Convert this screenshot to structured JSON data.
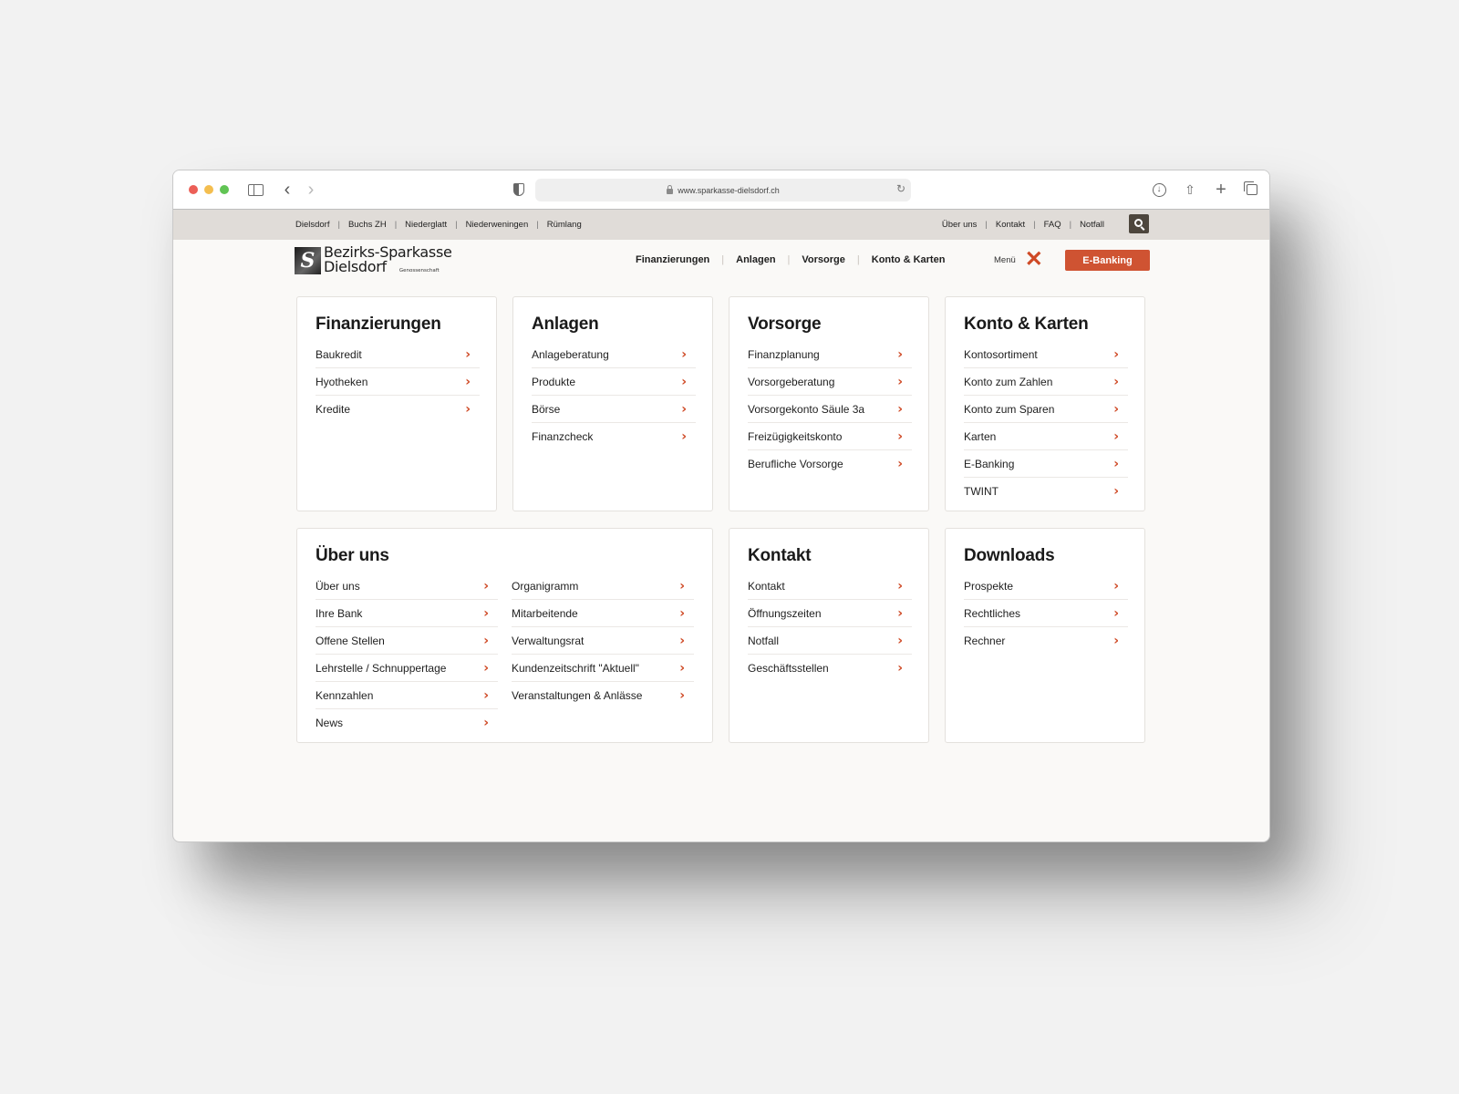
{
  "browser": {
    "url": "www.sparkasse-dielsdorf.ch",
    "icons": [
      "close-dot",
      "minimize-dot",
      "zoom-dot",
      "sidebar-icon",
      "back-icon",
      "forward-icon",
      "shield-icon",
      "lock-icon",
      "reload-icon",
      "download-icon",
      "share-icon",
      "new-tab-icon",
      "tabs-overview-icon"
    ]
  },
  "utility_nav": {
    "left": [
      "Dielsdorf",
      "Buchs ZH",
      "Niederglatt",
      "Niederweningen",
      "Rümlang"
    ],
    "right": [
      "Über uns",
      "Kontakt",
      "FAQ",
      "Notfall"
    ],
    "separator": "|"
  },
  "logo": {
    "line1": "Bezirks-Sparkasse",
    "line2": "Dielsdorf",
    "sub": "Genossenschaft",
    "mark": "S"
  },
  "main_nav": {
    "items": [
      "Finanzierungen",
      "Anlagen",
      "Vorsorge",
      "Konto & Karten"
    ],
    "menu_label": "Menü",
    "close_glyph": "✕",
    "ebanking": "E-Banking"
  },
  "colors": {
    "accent": "#cf5332",
    "utility_bar": "#e0dcd8",
    "search_button": "#4d463d",
    "page_bg": "#faf9f7"
  },
  "chevron": "›",
  "cards": {
    "finanzierungen": {
      "title": "Finanzierungen",
      "items": [
        "Baukredit",
        "Hyotheken",
        "Kredite"
      ]
    },
    "anlagen": {
      "title": "Anlagen",
      "items": [
        "Anlageberatung",
        "Produkte",
        "Börse",
        "Finanzcheck"
      ]
    },
    "vorsorge": {
      "title": "Vorsorge",
      "items": [
        "Finanzplanung",
        "Vorsorgeberatung",
        "Vorsorgekonto Säule 3a",
        "Freizügigkeitskonto",
        "Berufliche Vorsorge"
      ]
    },
    "konto": {
      "title": "Konto & Karten",
      "items": [
        "Kontosortiment",
        "Konto zum Zahlen",
        "Konto zum Sparen",
        "Karten",
        "E-Banking",
        "TWINT"
      ]
    },
    "ueber_uns": {
      "title": "Über uns",
      "col1": [
        "Über uns",
        "Ihre Bank",
        "Offene Stellen",
        "Lehrstelle / Schnuppertage",
        "Kennzahlen",
        "News"
      ],
      "col2": [
        "Organigramm",
        "Mitarbeitende",
        "Verwaltungsrat",
        "Kundenzeitschrift \"Aktuell\"",
        "Veranstaltungen & Anlässe"
      ]
    },
    "kontakt": {
      "title": "Kontakt",
      "items": [
        "Kontakt",
        "Öffnungszeiten",
        "Notfall",
        "Geschäftsstellen"
      ]
    },
    "downloads": {
      "title": "Downloads",
      "items": [
        "Prospekte",
        "Rechtliches",
        "Rechner"
      ]
    }
  }
}
